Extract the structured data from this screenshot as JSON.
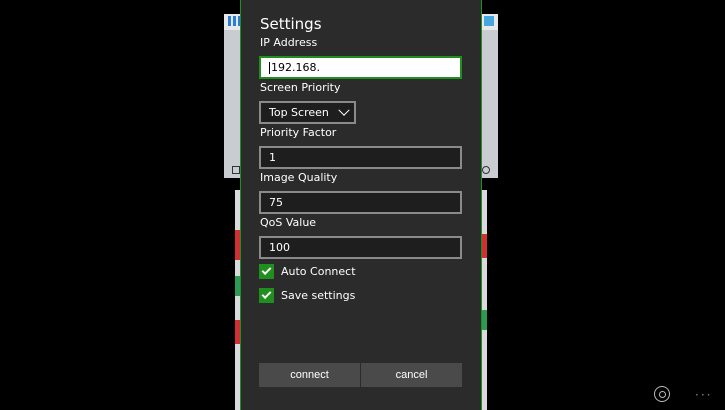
{
  "dialog": {
    "title": "Settings",
    "ip_label": "IP Address",
    "ip_value": "192.168.",
    "screen_priority_label": "Screen Priority",
    "screen_priority_value": "Top Screen",
    "priority_factor_label": "Priority Factor",
    "priority_factor_value": "1",
    "image_quality_label": "Image Quality",
    "image_quality_value": "75",
    "qos_label": "QoS Value",
    "qos_value": "100",
    "auto_connect_label": "Auto Connect",
    "auto_connect_checked": true,
    "save_settings_label": "Save settings",
    "save_settings_checked": true,
    "connect_label": "connect",
    "cancel_label": "cancel"
  },
  "system": {
    "more_label": "···"
  },
  "colors": {
    "accent": "#1f8f1f",
    "dialog_bg": "#2b2b2b",
    "button_bg": "#4a4a4a"
  }
}
